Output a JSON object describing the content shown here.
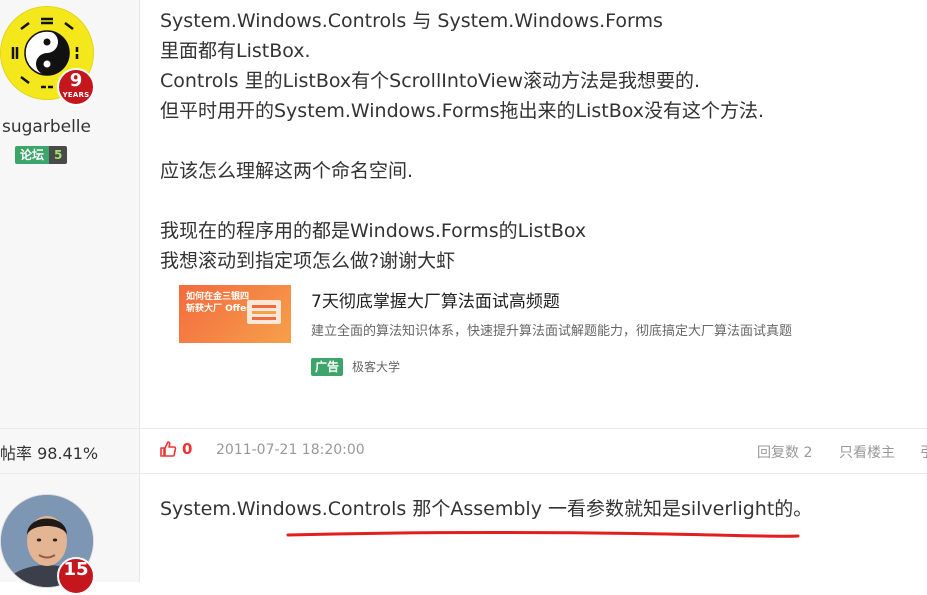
{
  "post1": {
    "user": {
      "name": "sugarbelle",
      "years": "9",
      "years_label": "YEARS",
      "forum_tag": "论坛",
      "level": "5",
      "rate": "帖率 98.41%"
    },
    "lines": [
      "System.Windows.Controls 与 System.Windows.Forms",
      "里面都有ListBox.",
      "Controls 里的ListBox有个ScrollIntoView滚动方法是我想要的.",
      "但平时用开的System.Windows.Forms拖出来的ListBox没有这个方法.",
      "",
      "应该怎么理解这两个命名空间.",
      "",
      "我现在的程序用的都是Windows.Forms的ListBox",
      "我想滚动到指定项怎么做?谢谢大虾"
    ],
    "ad": {
      "image_text_1": "如何在金三银四",
      "image_text_2": "斩获大厂 Offer？",
      "title": "7天彻底掌握大厂算法面试高频题",
      "desc": "建立全面的算法知识体系，快速提升算法面试解题能力，彻底搞定大厂算法面试真题",
      "tag": "广告",
      "source": "极客大学"
    },
    "actions": {
      "like_count": "0",
      "time": "2011-07-21 18:20:00",
      "reply_count": "回复数 2",
      "only_op": "只看楼主",
      "quote": "引"
    }
  },
  "post2": {
    "user": {
      "years": "15"
    },
    "text": "System.Windows.Controls 那个Assembly 一看参数就知是silverlight的。"
  },
  "colors": {
    "accent_red": "#e33333",
    "level_green": "#3da56a",
    "badge_red": "#c4161c"
  }
}
